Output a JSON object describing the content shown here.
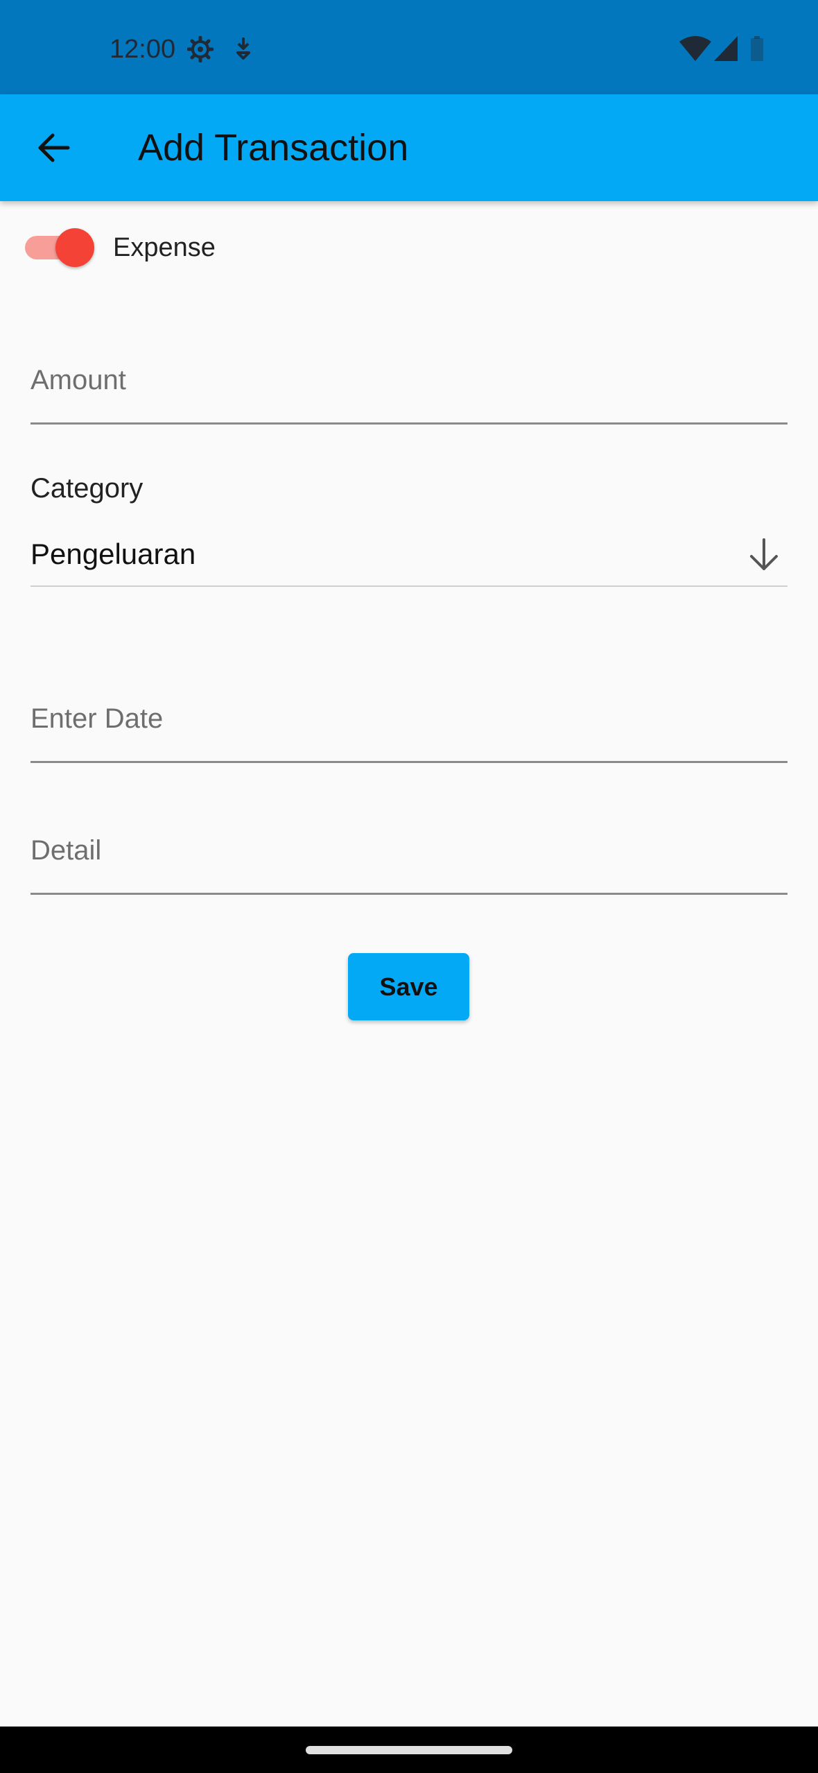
{
  "status_bar": {
    "time": "12:00",
    "icons": [
      "settings-gear-icon",
      "download-icon",
      "wifi-icon",
      "signal-icon",
      "battery-icon"
    ]
  },
  "app_bar": {
    "title": "Add Transaction",
    "back_icon": "arrow-left-icon"
  },
  "transaction_type": {
    "label": "Expense",
    "toggle_on": true
  },
  "amount_field": {
    "placeholder": "Amount",
    "value": ""
  },
  "category": {
    "label": "Category",
    "selected": "Pengeluaran",
    "arrow_icon": "arrow-down-icon"
  },
  "date_field": {
    "placeholder": "Enter Date",
    "value": ""
  },
  "detail_field": {
    "placeholder": "Detail",
    "value": ""
  },
  "actions": {
    "save_label": "Save"
  },
  "colors": {
    "status_bar": "#0277bd",
    "app_bar": "#03a9f4",
    "switch_thumb": "#f44336",
    "switch_track": "#f79e99",
    "background": "#fafafa"
  }
}
